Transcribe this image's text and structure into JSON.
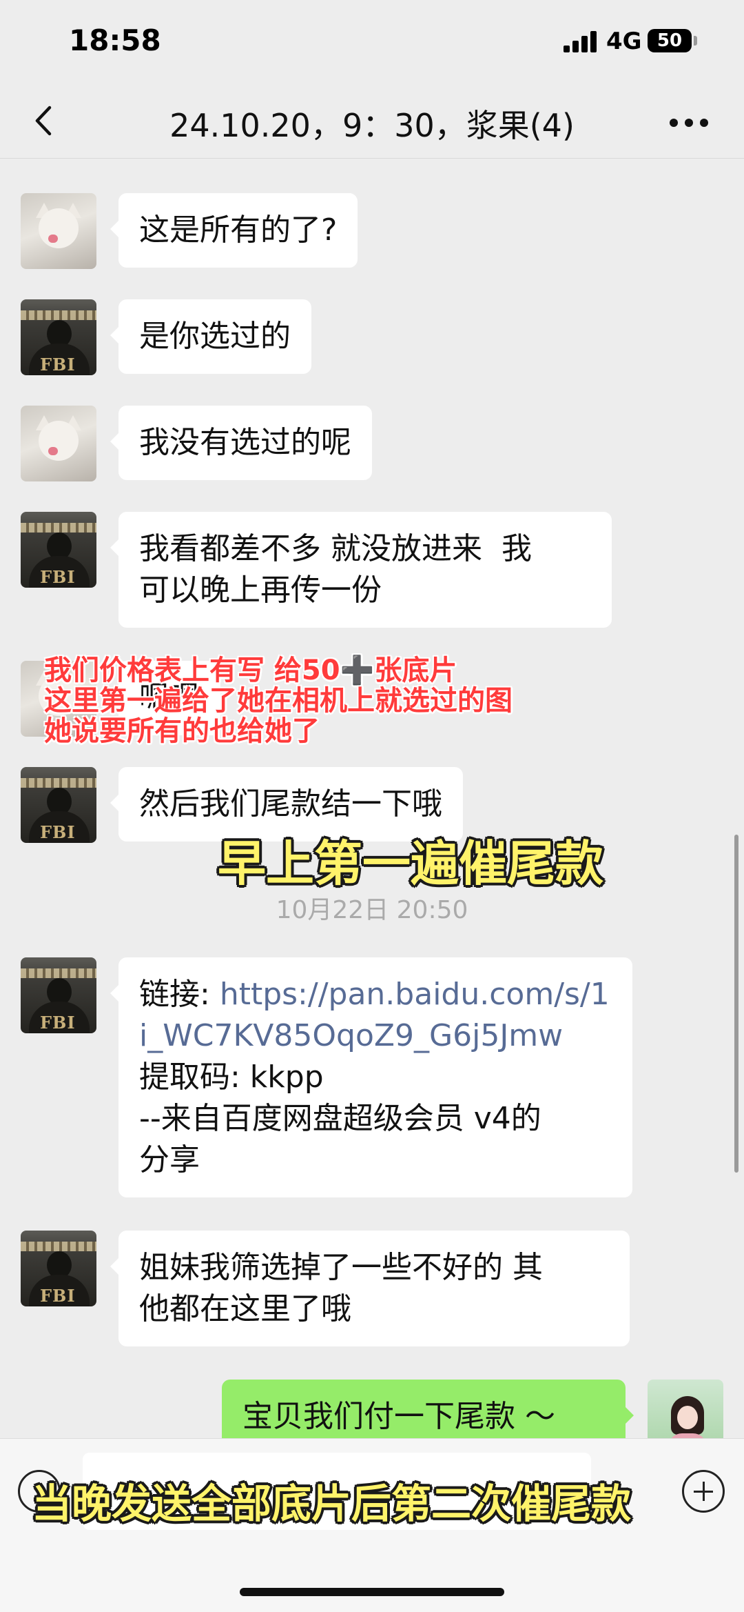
{
  "status_bar": {
    "time": "18:58",
    "network": "4G",
    "battery": "50"
  },
  "header": {
    "title": "24.10.20，9：30，浆果(4)"
  },
  "messages": [
    {
      "text": "这是所有的了?"
    },
    {
      "text": "是你选过的"
    },
    {
      "text": "我没有选过的呢"
    },
    {
      "text": "我看都差不多 就没放进来  我\n可以晚上再传一份"
    },
    {
      "text": "嗯嗯"
    },
    {
      "text": "然后我们尾款结一下哦"
    },
    {
      "timestamp": "10月22日 20:50"
    },
    {
      "label": "链接: ",
      "link": "https://pan.baidu.com/s/1i_WC7KV85OqoZ9_G6j5Jmw",
      "extra": "提取码: kkpp\n--来自百度网盘超级会员 v4的\n分享"
    },
    {
      "text": "姐妹我筛选掉了一些不好的 其\n他都在这里了哦"
    },
    {
      "text": "宝贝我们付一下尾款 ～"
    }
  ],
  "overlays": {
    "red_note": "我们价格表上有写 给50➕张底片\n这里第一遍给了她在相机上就选过的图\n她说要所有的也给她了",
    "caption_1": "早上第一遍催尾款",
    "caption_2": "当晚发送全部底片后第二次催尾款"
  }
}
